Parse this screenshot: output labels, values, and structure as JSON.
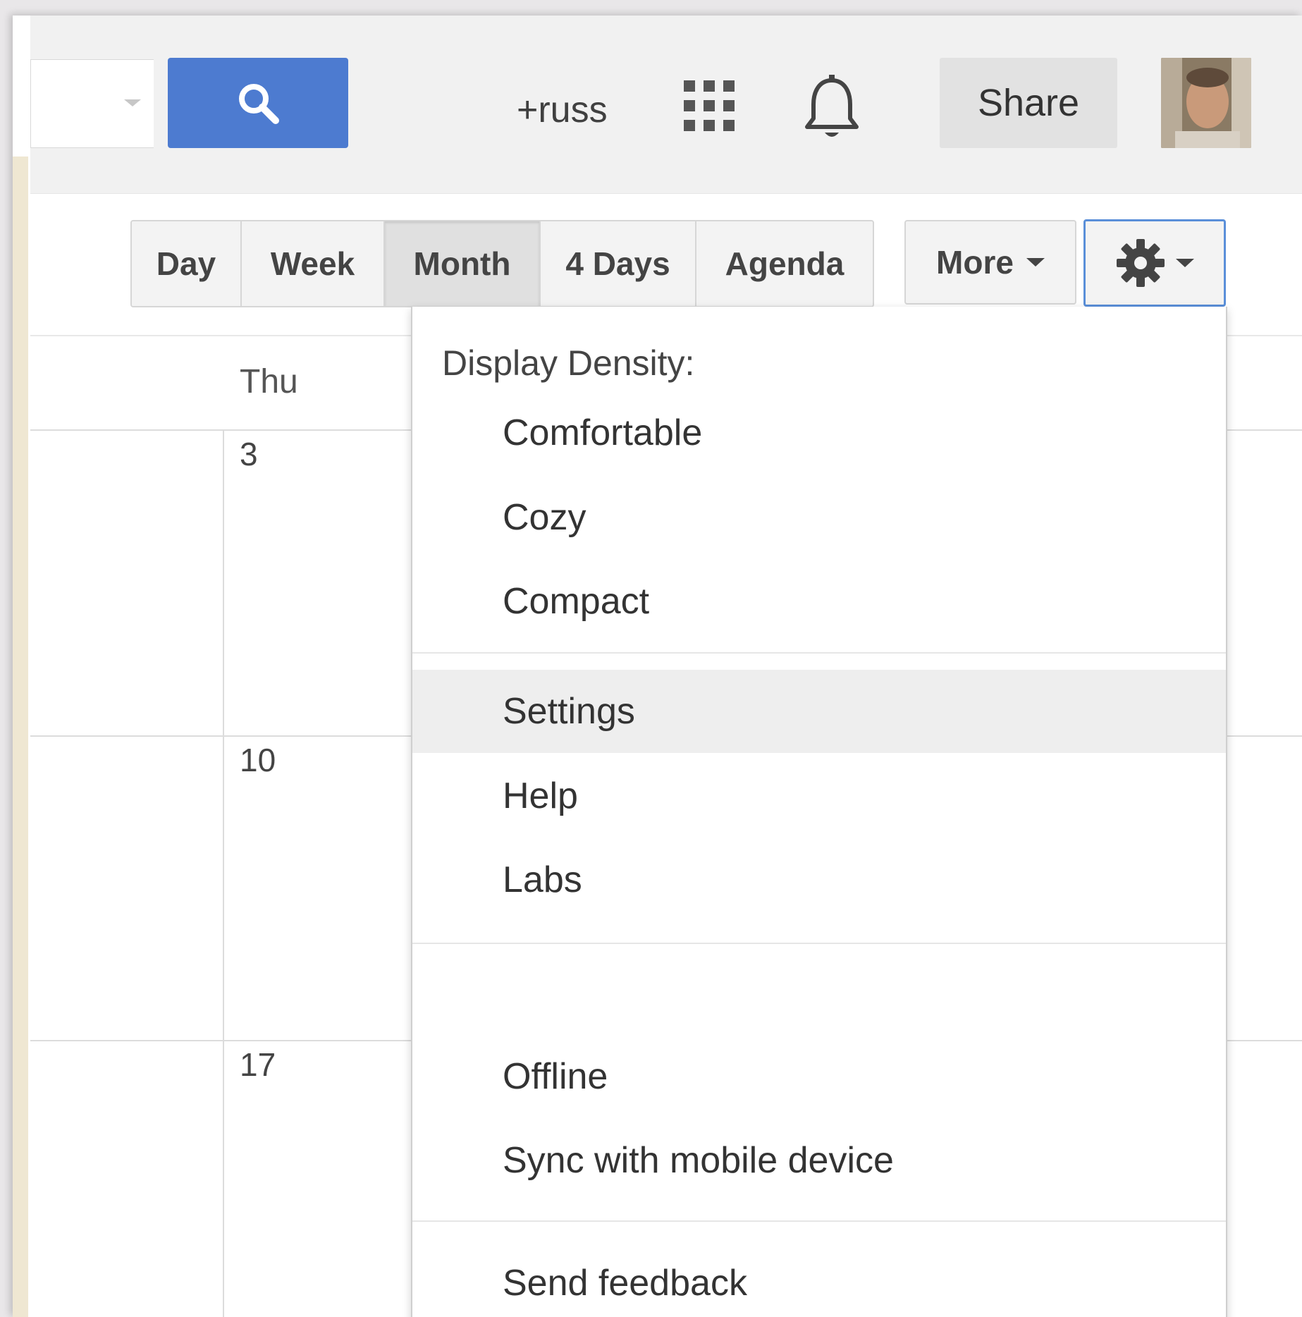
{
  "header": {
    "plus_link": "+russ",
    "share_label": "Share",
    "colors": {
      "search_button": "#4d7bd0",
      "header_bg": "#f1f1f1"
    },
    "icons": [
      "search-icon",
      "apps-grid-icon",
      "bell-icon",
      "avatar"
    ]
  },
  "toolbar": {
    "views": [
      "Day",
      "Week",
      "Month",
      "4 Days",
      "Agenda"
    ],
    "active_view": "Month",
    "more_label": "More",
    "settings_icon": "gear-icon"
  },
  "calendar": {
    "day_header": "Thu",
    "dates": [
      "3",
      "10",
      "17"
    ]
  },
  "menu": {
    "heading": "Display Density:",
    "density_options": [
      "Comfortable",
      "Cozy",
      "Compact"
    ],
    "items": [
      "Settings",
      "Help",
      "Labs"
    ],
    "highlighted_item": "Settings",
    "sync_items": [
      "Offline",
      "Sync with mobile device"
    ],
    "feedback": "Send feedback"
  }
}
